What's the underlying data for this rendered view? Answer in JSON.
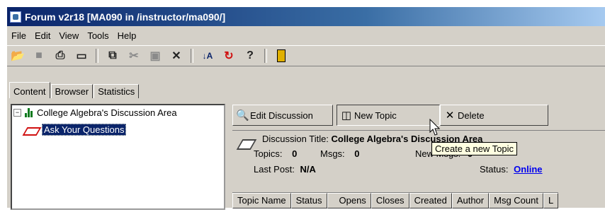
{
  "window": {
    "title": "Forum v2r18  [MA090 in /instructor/ma090/]"
  },
  "menu": [
    "File",
    "Edit",
    "View",
    "Tools",
    "Help"
  ],
  "tabs": [
    {
      "label": "Content",
      "active": true
    },
    {
      "label": "Browser",
      "active": false
    },
    {
      "label": "Statistics",
      "active": false
    }
  ],
  "tree": {
    "root": "College Algebra's Discussion Area",
    "root_expander": "−",
    "child": "Ask Your Questions"
  },
  "actions": {
    "edit": "Edit Discussion",
    "new_topic": "New Topic",
    "delete": "Delete"
  },
  "discussion": {
    "title_label": "Discussion Title:",
    "title_value": "College Algebra's Discussion Area",
    "topics_label": "Topics:",
    "topics_value": "0",
    "msgs_label": "Msgs:",
    "msgs_value": "0",
    "new_msgs_label": "New Msgs:",
    "new_msgs_value": "0",
    "last_post_label": "Last Post:",
    "last_post_value": "N/A",
    "status_label": "Status:",
    "status_value": "Online"
  },
  "grid_columns": [
    "Topic Name",
    "Status",
    "Opens",
    "Closes",
    "Created",
    "Author",
    "Msg Count",
    "L"
  ],
  "tooltip": "Create a new Topic",
  "colors": {
    "title_start": "#0a246a",
    "title_end": "#a6caf0",
    "selection": "#0a246a",
    "link": "#0000ee"
  }
}
